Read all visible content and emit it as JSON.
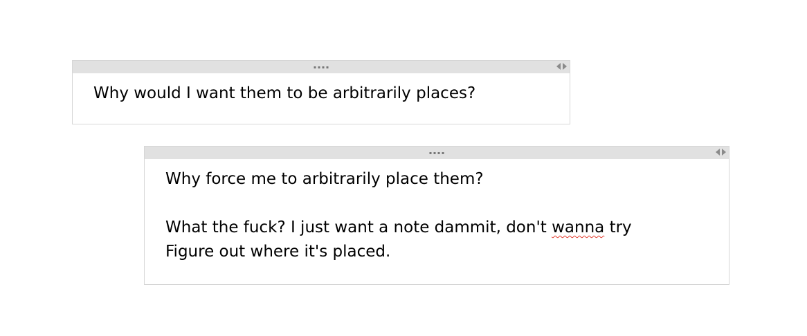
{
  "notes": [
    {
      "lines": [
        "Why would I want them to be arbitrarily places?"
      ]
    },
    {
      "lines": [
        "Why force me to arbitrarily place them?",
        "What the fuck? I just want a note dammit, don't ",
        "wanna",
        " try",
        "Figure out where it's placed."
      ]
    }
  ],
  "colors": {
    "header_bg": "#e1e1e1",
    "border": "#d6d6d6",
    "spellcheck": "#e23b2e"
  },
  "icons": {
    "drag_handle": "four-dot-grip",
    "resize": "left-right-arrows"
  }
}
